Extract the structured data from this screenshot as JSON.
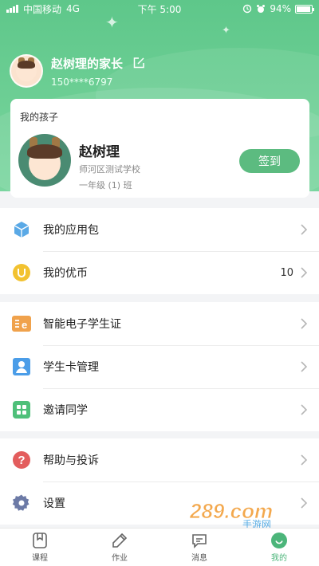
{
  "status_bar": {
    "carrier": "中国移动",
    "network": "4G",
    "time": "下午 5:00",
    "battery": "94%",
    "battery_level": 0.94
  },
  "profile": {
    "name": "赵树理的家长",
    "phone": "150****6797"
  },
  "child_card": {
    "title": "我的孩子",
    "name": "赵树理",
    "school": "师河区测试学校",
    "grade": "一年级 (1) 班",
    "sign_in_label": "签到"
  },
  "menu_groups": [
    [
      {
        "label": "我的应用包",
        "icon": "cube-icon",
        "value": ""
      },
      {
        "label": "我的优币",
        "icon": "coin-icon",
        "value": "10"
      }
    ],
    [
      {
        "label": "智能电子学生证",
        "icon": "student-id-icon",
        "value": ""
      },
      {
        "label": "学生卡管理",
        "icon": "user-card-icon",
        "value": ""
      },
      {
        "label": "邀请同学",
        "icon": "grid-icon",
        "value": ""
      }
    ],
    [
      {
        "label": "帮助与投诉",
        "icon": "question-icon",
        "value": ""
      },
      {
        "label": "设置",
        "icon": "gear-icon",
        "value": ""
      }
    ]
  ],
  "tabs": [
    {
      "label": "课程",
      "icon": "bookmark-icon",
      "active": false
    },
    {
      "label": "作业",
      "icon": "pencil-icon",
      "active": false
    },
    {
      "label": "消息",
      "icon": "message-icon",
      "active": false
    },
    {
      "label": "我的",
      "icon": "me-icon",
      "active": true
    }
  ],
  "watermark": {
    "text": "289.com",
    "subtext": "手游网"
  },
  "colors": {
    "brand_green": "#5cbb80",
    "active_tab": "#4cb57a",
    "coin": "#f2c230",
    "help_red": "#e35d5d"
  }
}
